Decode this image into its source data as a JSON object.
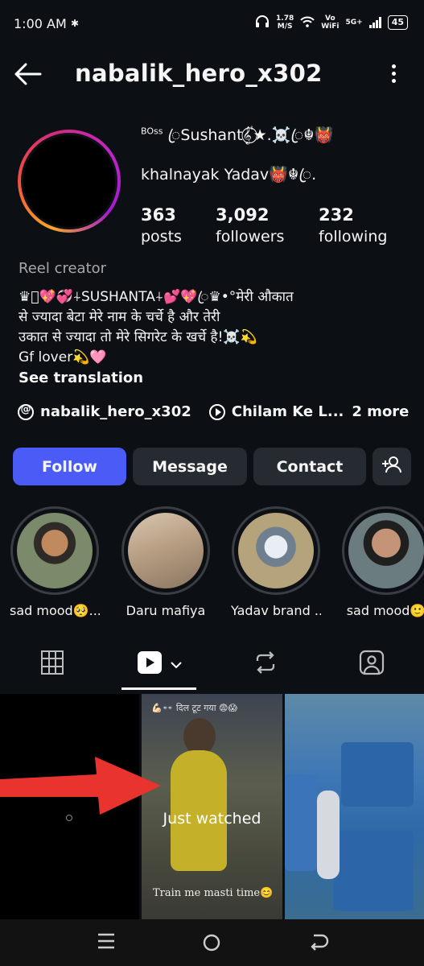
{
  "status": {
    "time": "1:00 AM",
    "net_speed_value": "1.78",
    "net_speed_unit": "M/S",
    "vowifi_top": "Vo",
    "vowifi_bottom": "WiFi",
    "network": "5G+",
    "battery": "45"
  },
  "header": {
    "username": "nabalik_hero_x302"
  },
  "profile": {
    "name_prefix": "BOss",
    "name_line1": "ꦿSushant︎𝄟⃝★.☠️ꦿ☬👹",
    "name_line2": "khalnayak Yadav👹☬ꦿ.",
    "stats": [
      {
        "value": "363",
        "label": "posts"
      },
      {
        "value": "3,092",
        "label": "followers"
      },
      {
        "value": "232",
        "label": "following"
      }
    ],
    "category": "Reel creator",
    "bio_lines": [
      "♛ꦿ💖💞⍭SUSHANTA⍭💕💖ꦿ♛•°मेरी औकात",
      "से ज्यादा बेटा मेरे नाम के चर्चे है और तेरी",
      "उकात से ज्यादा तो मेरे सिगरेट के खर्चे है!☠️💫",
      "Gf lover💫🩷"
    ],
    "see_translation": "See translation",
    "threads_handle": "nabalik_hero_x302",
    "link_text": "Chilam Ke L...",
    "more_links": "2 more"
  },
  "actions": {
    "follow": "Follow",
    "message": "Message",
    "contact": "Contact"
  },
  "highlights": [
    {
      "label": "sad mood🥺..."
    },
    {
      "label": "Daru mafiya"
    },
    {
      "label": "Yadav brand ..."
    },
    {
      "label": "sad mood🙂"
    }
  ],
  "grid": {
    "just_watched": "Just watched",
    "caption_top": "💪🏻👓 दिल टूट गया 😨😱",
    "caption_bottom": "Train me masti time😊"
  },
  "colors": {
    "follow_button": "#4b5cf6",
    "background": "#0c0f14",
    "arrow": "#e8332f"
  }
}
